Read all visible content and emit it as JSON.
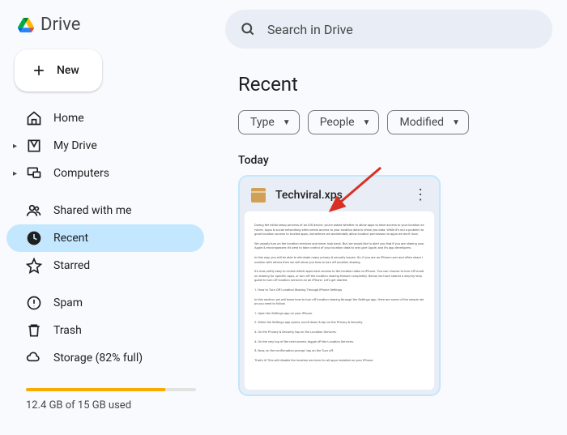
{
  "app": {
    "name": "Drive"
  },
  "sidebar": {
    "new_label": "New",
    "nav1": [
      {
        "label": "Home"
      },
      {
        "label": "My Drive"
      },
      {
        "label": "Computers"
      }
    ],
    "nav2": [
      {
        "label": "Shared with me"
      },
      {
        "label": "Recent"
      },
      {
        "label": "Starred"
      }
    ],
    "nav3": [
      {
        "label": "Spam"
      },
      {
        "label": "Trash"
      },
      {
        "label": "Storage (82% full)"
      }
    ],
    "storage": {
      "percent": 82,
      "text": "12.4 GB of 15 GB used"
    }
  },
  "search": {
    "placeholder": "Search in Drive"
  },
  "main": {
    "title": "Recent",
    "filters": [
      {
        "label": "Type"
      },
      {
        "label": "People"
      },
      {
        "label": "Modified"
      }
    ],
    "section_label": "Today",
    "file": {
      "name": "Techviral.xps"
    }
  }
}
